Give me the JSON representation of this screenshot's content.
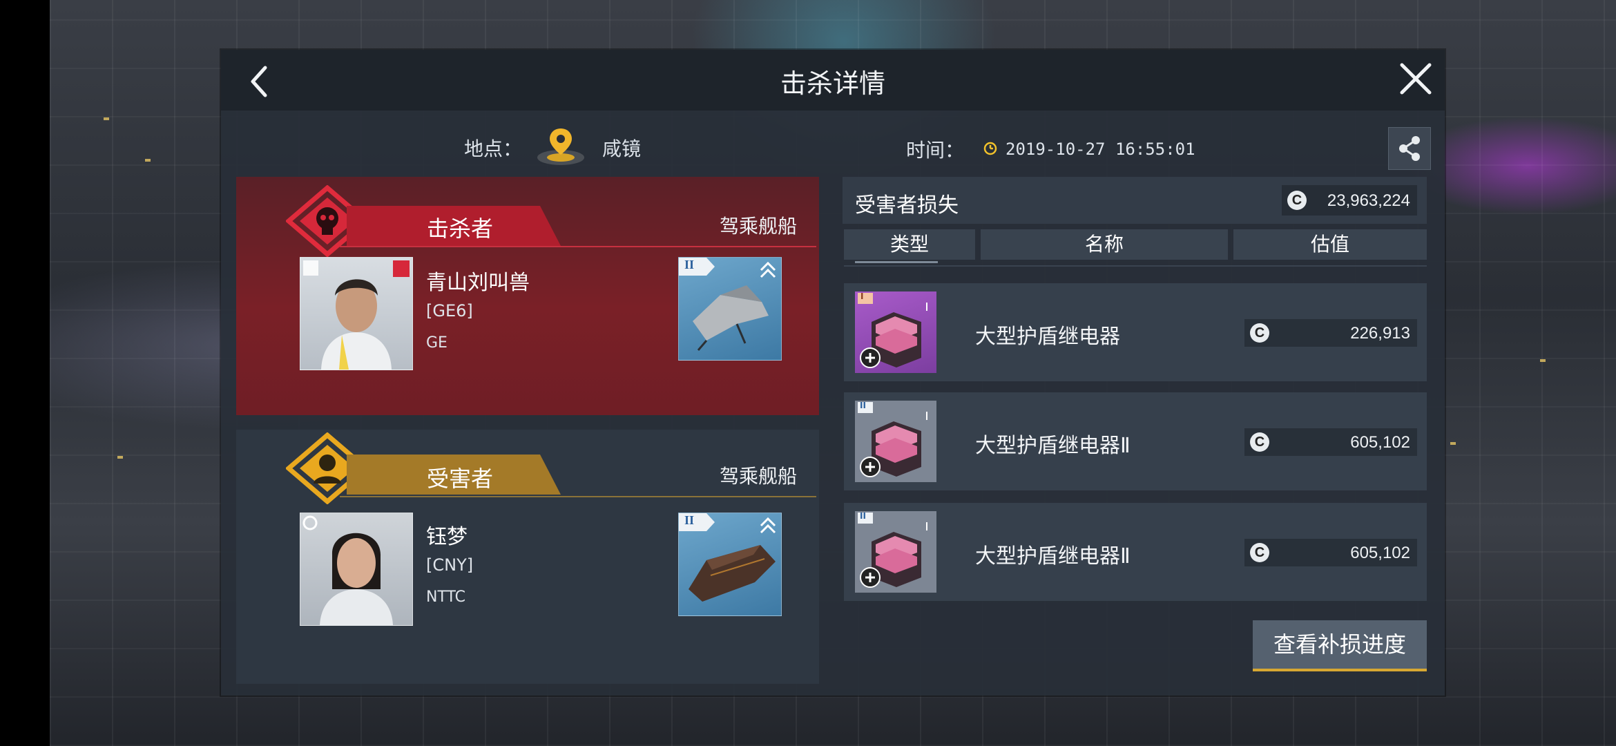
{
  "header": {
    "title": "击杀详情"
  },
  "info": {
    "location_label": "地点：",
    "location_value": "咸镜",
    "time_label": "时间：",
    "time_value": "2019-10-27 16:55:01"
  },
  "killer": {
    "role_label": "击杀者",
    "ship_label": "驾乘舰船",
    "name": "青山刘叫兽",
    "corp": "[GE6]",
    "alliance": "GE",
    "ship_tier": "II"
  },
  "victim": {
    "role_label": "受害者",
    "ship_label": "驾乘舰船",
    "name": "钰梦",
    "corp": "[CNY]",
    "alliance": "NTTC",
    "ship_tier": "II"
  },
  "loss": {
    "label": "受害者损失",
    "currency_symbol": "C",
    "total": "23,963,224",
    "columns": [
      "类型",
      "名称",
      "估值"
    ],
    "items": [
      {
        "name": "大型护盾继电器",
        "tier": "I",
        "value": "226,913"
      },
      {
        "name": "大型护盾继电器Ⅱ",
        "tier": "II",
        "value": "605,102"
      },
      {
        "name": "大型护盾继电器Ⅱ",
        "tier": "II",
        "value": "605,102"
      }
    ]
  },
  "actions": {
    "view_progress": "查看补损进度"
  },
  "colors": {
    "killer_red": "#d6283a",
    "victim_gold": "#e9a81f",
    "accent": "#d7a832"
  }
}
